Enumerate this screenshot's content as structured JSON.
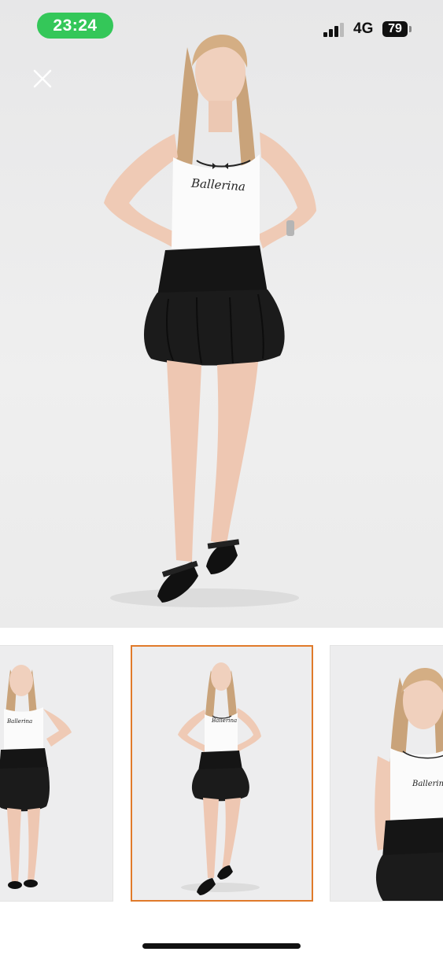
{
  "status_bar": {
    "time": "23:24",
    "network": "4G",
    "battery": "79"
  },
  "hero": {
    "shirt_print": "Ballerina"
  },
  "thumbnails": [
    {
      "shirt_print": "Ballerina",
      "selected": false
    },
    {
      "shirt_print": "Ballerina",
      "selected": true
    },
    {
      "shirt_print": "Ballerina",
      "selected": false
    }
  ],
  "icons": {
    "close": "close-icon",
    "signal": "signal-icon",
    "battery": "battery-icon"
  },
  "colors": {
    "time_pill": "#34c759",
    "selected_border": "#e07a2a",
    "skirt": "#151515"
  }
}
